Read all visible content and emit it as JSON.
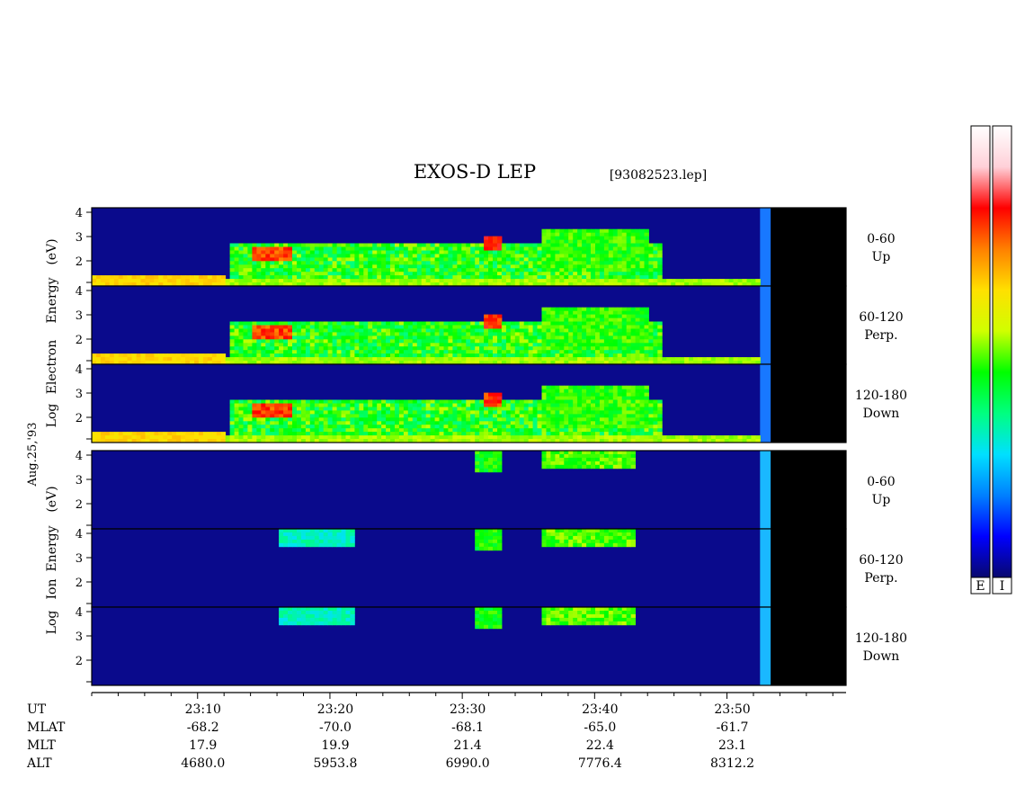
{
  "header": {
    "title": "EXOS-D LEP",
    "file": "[93082523.lep]"
  },
  "chart_data": {
    "type": "heatmap",
    "title": "EXOS-D LEP",
    "file_label": "[93082523.lep]",
    "date_label": "Aug.25,'93",
    "x_time_range_minutes": [
      2,
      59
    ],
    "panel_groups": [
      {
        "id": "electron",
        "ylabel_words": [
          "Log",
          "Electron",
          "Energy",
          "(eV)"
        ],
        "ylim_log_eV": [
          1,
          4
        ],
        "yticks": [
          "4",
          "3",
          "2"
        ],
        "panels": [
          {
            "name": "Up",
            "pitch_range": "0-60",
            "direction": "Up"
          },
          {
            "name": "Perp.",
            "pitch_range": "60-120",
            "direction": "Perp."
          },
          {
            "name": "Down",
            "pitch_range": "120-180",
            "direction": "Down"
          }
        ],
        "data_end_time": "23:52"
      },
      {
        "id": "ion",
        "ylabel_words": [
          "Log",
          "Ion",
          "Energy",
          "(eV)"
        ],
        "ylim_log_eV": [
          1,
          4
        ],
        "yticks": [
          "4",
          "3",
          "2"
        ],
        "panels": [
          {
            "name": "Up",
            "pitch_range": "0-60",
            "direction": "Up"
          },
          {
            "name": "Perp.",
            "pitch_range": "60-120",
            "direction": "Perp."
          },
          {
            "name": "Down",
            "pitch_range": "120-180",
            "direction": "Down"
          }
        ],
        "data_end_time": "23:52"
      }
    ],
    "colorbars": [
      {
        "label": "E",
        "colors": [
          "#08086e",
          "#0000ff",
          "#0080ff",
          "#00e0ff",
          "#00ff80",
          "#00ff00",
          "#d0ff00",
          "#ffe000",
          "#ff8000",
          "#ff0000",
          "#ffd0d8",
          "#ffffff"
        ]
      },
      {
        "label": "I",
        "colors": [
          "#08086e",
          "#0000ff",
          "#0080ff",
          "#00e0ff",
          "#00ff80",
          "#00ff00",
          "#d0ff00",
          "#ffe000",
          "#ff8000",
          "#ff0000",
          "#ffd0d8",
          "#ffffff"
        ]
      }
    ],
    "table": {
      "row_labels": [
        "UT",
        "MLAT",
        "MLT",
        "ALT"
      ],
      "columns": [
        {
          "UT": "23:10",
          "MLAT": "-68.2",
          "MLT": "17.9",
          "ALT": "4680.0"
        },
        {
          "UT": "23:20",
          "MLAT": "-70.0",
          "MLT": "19.9",
          "ALT": "5953.8"
        },
        {
          "UT": "23:30",
          "MLAT": "-68.1",
          "MLT": "21.4",
          "ALT": "6990.0"
        },
        {
          "UT": "23:40",
          "MLAT": "-65.0",
          "MLT": "22.4",
          "ALT": "7776.4"
        },
        {
          "UT": "23:50",
          "MLAT": "-61.7",
          "MLT": "23.1",
          "ALT": "8312.2"
        }
      ],
      "column_times_minutes": [
        10,
        20,
        30,
        40,
        50
      ]
    }
  }
}
